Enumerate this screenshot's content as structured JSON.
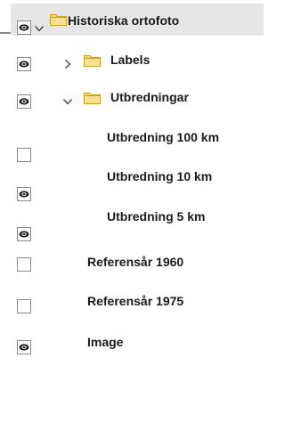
{
  "layers": {
    "items": [
      {
        "label": "Historiska ortofoto",
        "visible": true,
        "expanded": true,
        "type": "group"
      },
      {
        "label": "Labels",
        "visible": true,
        "expanded": false,
        "type": "group"
      },
      {
        "label": "Utbredningar",
        "visible": true,
        "expanded": true,
        "type": "group"
      },
      {
        "label": "Utbredning 100 km",
        "visible": false,
        "type": "layer"
      },
      {
        "label": "Utbredning 10 km",
        "visible": true,
        "type": "layer"
      },
      {
        "label": "Utbredning 5 km",
        "visible": true,
        "type": "layer"
      },
      {
        "label": "Referensår 1960",
        "visible": false,
        "type": "layer"
      },
      {
        "label": "Referensår 1975",
        "visible": false,
        "type": "layer"
      },
      {
        "label": "Image",
        "visible": true,
        "type": "layer"
      }
    ]
  },
  "icons": {
    "visibility": "eye-icon",
    "expand": "chevron-down-icon",
    "collapse": "chevron-right-icon",
    "group": "folder-icon"
  },
  "colors": {
    "selected_row": "#e6e6e6",
    "folder_fill": "#f5d36b",
    "folder_stroke": "#c9a227"
  }
}
